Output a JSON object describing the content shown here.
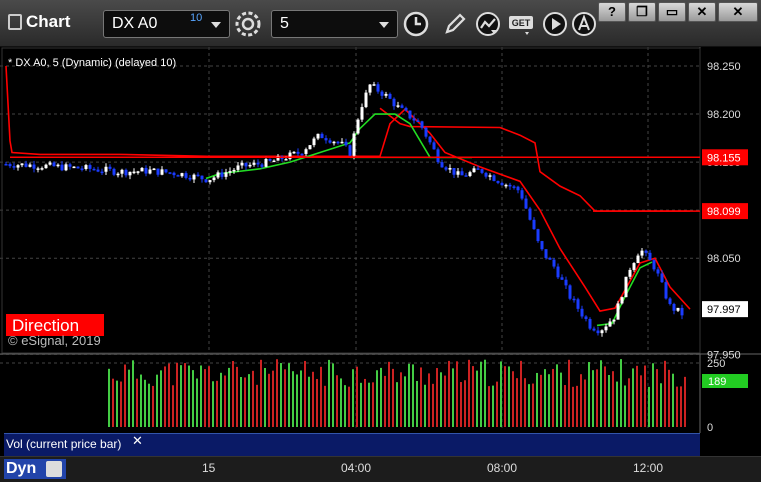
{
  "window": {
    "title": "Chart",
    "help_label": "?",
    "restore_label": "❐",
    "minimize_label": "▭",
    "close_label": "✕"
  },
  "toolbar": {
    "symbol": "DX A0",
    "symbol_superscript": "10",
    "interval": "5",
    "buttons": [
      "settings-icon",
      "clock-icon",
      "pencil-icon",
      "study-icon",
      "get-icon",
      "play-icon",
      "alert-icon"
    ],
    "get_label": "GET"
  },
  "chart": {
    "legend_text": "* DX A0, 5 (Dynamic) (delayed 10)",
    "direction_label": "Direction",
    "copyright": "© eSignal, 2019",
    "price_ticks": [
      "98.250",
      "98.200",
      "98.150",
      "98.100",
      "98.050",
      "97.997",
      "97.950"
    ],
    "markers": [
      {
        "label": "98.155",
        "color": "#ff0000"
      },
      {
        "label": "98.099",
        "color": "#ff0000"
      },
      {
        "label": "97.997",
        "color": "#ffffff"
      }
    ],
    "colors": {
      "up": "#ffffff",
      "down": "#1a3cff",
      "red_line": "#ff0000",
      "green_line": "#22dd22"
    }
  },
  "volume": {
    "ticks": [
      "250",
      "0"
    ],
    "value_badge": "189",
    "label": "Vol (current price bar)",
    "close": "✕",
    "colors": {
      "up": "#44cc44",
      "down": "#cc2222",
      "badge": "#22cc22"
    }
  },
  "x_axis": {
    "ticks": [
      "15",
      "04:00",
      "08:00",
      "12:00"
    ]
  },
  "statusbar": {
    "mode": "Dyn"
  }
}
